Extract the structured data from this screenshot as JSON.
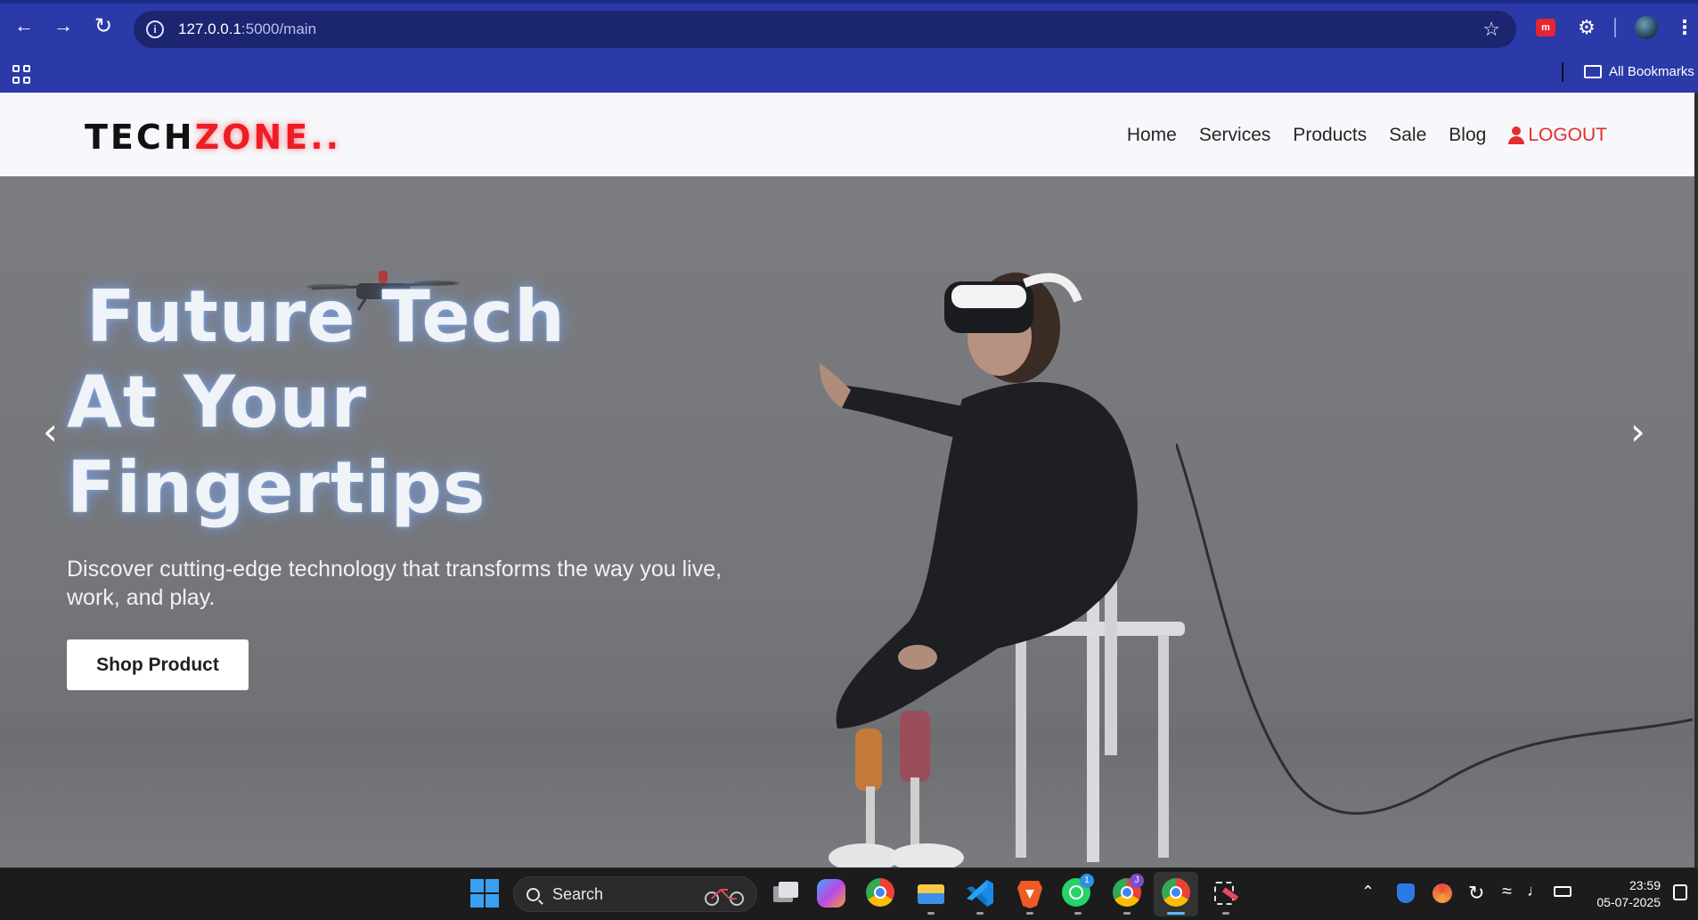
{
  "browser": {
    "url_host": "127.0.0.1",
    "url_path": ":5000/main",
    "bookmarks_label": "All Bookmarks",
    "extension_badge": "m"
  },
  "site": {
    "logo_part1": "TECH",
    "logo_part2": "ZONE..",
    "nav": [
      "Home",
      "Services",
      "Products",
      "Sale",
      "Blog"
    ],
    "logout_label": "LOGOUT"
  },
  "hero": {
    "headline_line1": "Future Tech",
    "headline_line2": "At Your",
    "headline_line3": "Fingertips",
    "subtext": "Discover cutting-edge technology that transforms the way you live, work, and play.",
    "button_label": "Shop Product",
    "prev_arrow": "‹",
    "next_arrow": "›"
  },
  "taskbar": {
    "search_label": "Search",
    "whatsapp_badge": "1",
    "chrome_profile_badge": "J",
    "time": "23:59",
    "date": "05-07-2025"
  },
  "colors": {
    "browser_chrome": "#2b3aa8",
    "logo_accent": "#ee1c25",
    "logout_accent": "#e62c2c",
    "taskbar": "#1c1c1c"
  }
}
